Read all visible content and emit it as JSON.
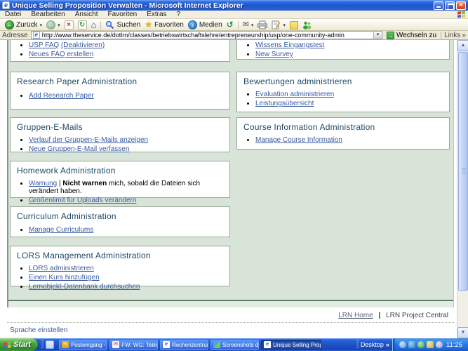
{
  "window": {
    "title": "Unique Selling Proposition Verwalten - Microsoft Internet Explorer"
  },
  "menu": {
    "items": [
      "Datei",
      "Bearbeiten",
      "Ansicht",
      "Favoriten",
      "Extras",
      "?"
    ]
  },
  "toolbar": {
    "back_label": "Zurück",
    "search_label": "Suchen",
    "favorites_label": "Favoriten",
    "media_label": "Medien"
  },
  "address": {
    "label": "Adresse",
    "url": "http://www.theservice.de/dotlrn/classes/betriebswirtschaftslehre/entrepreneurship/usp/one-community-admin",
    "go_label": "Wechseln zu",
    "links_label": "Links"
  },
  "content": {
    "left_panels": [
      {
        "links": [
          "USP FAQ",
          "(Deaktivieren)",
          "Neues FAQ erstellen"
        ]
      },
      {
        "title": "Research Paper Administration",
        "links": [
          "Add Research Paper"
        ]
      },
      {
        "title": "Gruppen-E-Mails",
        "links": [
          "Verlauf der Gruppen-E-Mails anzeigen",
          "Neue Gruppen-E-Mail verfassen"
        ]
      },
      {
        "title": "Homework Administration",
        "warning_link": "Warnung",
        "warning_separator": "|",
        "warning_bold": "Nicht warnen",
        "warning_rest": "mich, sobald die Dateien sich verändert haben.",
        "links": [
          "Größenlimit für Uploads verändern"
        ]
      },
      {
        "title": "Curriculum Administration",
        "links": [
          "Manage Curriculums"
        ]
      },
      {
        "title": "LORS Management Administration",
        "links": [
          "LORS administrieren",
          "Einen Kurs hinzufügen",
          "Lernobjekt-Datenbank durchsuchen"
        ]
      }
    ],
    "right_panels": [
      {
        "links": [
          "Wissens Eingangstest",
          "New Survey"
        ]
      },
      {
        "title": "Bewertungen administrieren",
        "links": [
          "Evaluation administrieren",
          "Leistungsübersicht"
        ]
      },
      {
        "title": "Course Information Administration",
        "links": [
          "Manage Course Information"
        ]
      }
    ],
    "footer": {
      "lrn_home": "LRN Home",
      "separator": "|",
      "lrn_project_central": "LRN Project Central",
      "language_link": "Sprache einstellen"
    }
  },
  "taskbar": {
    "start_label": "Start",
    "tasks": [
      "Posteingang - Micros...",
      "FW: WG: Teilnahme v...",
      "Rechenzentrum Uni K...",
      "Screenshots dotLRN...",
      "Unique Selling Proposi..."
    ],
    "desktop_label": "Desktop",
    "overflow_chevron": "»",
    "clock": "11:25"
  },
  "icons": {
    "ie_letter": "e",
    "close": "×",
    "back_arrow": "←",
    "forward_arrow": "→",
    "stop": "×",
    "refresh": "↻",
    "home": "⌂",
    "favorites_star": "★",
    "media_note": "♪",
    "history": "↺",
    "mail": "✉",
    "dropdown": "▾",
    "go_arrow": "→",
    "links_chevron": "»",
    "scroll_up": "▲",
    "scroll_down": "▼",
    "task_mail": "✉",
    "task_msg": "✉"
  },
  "colors": {
    "titlebar_blue": "#2a63da",
    "taskbar_blue": "#1f53c8",
    "start_green": "#3c9d38",
    "page_background": "#d8e4d8",
    "panel_heading": "#1e4a68",
    "link_blue": "#3a5a9f"
  }
}
